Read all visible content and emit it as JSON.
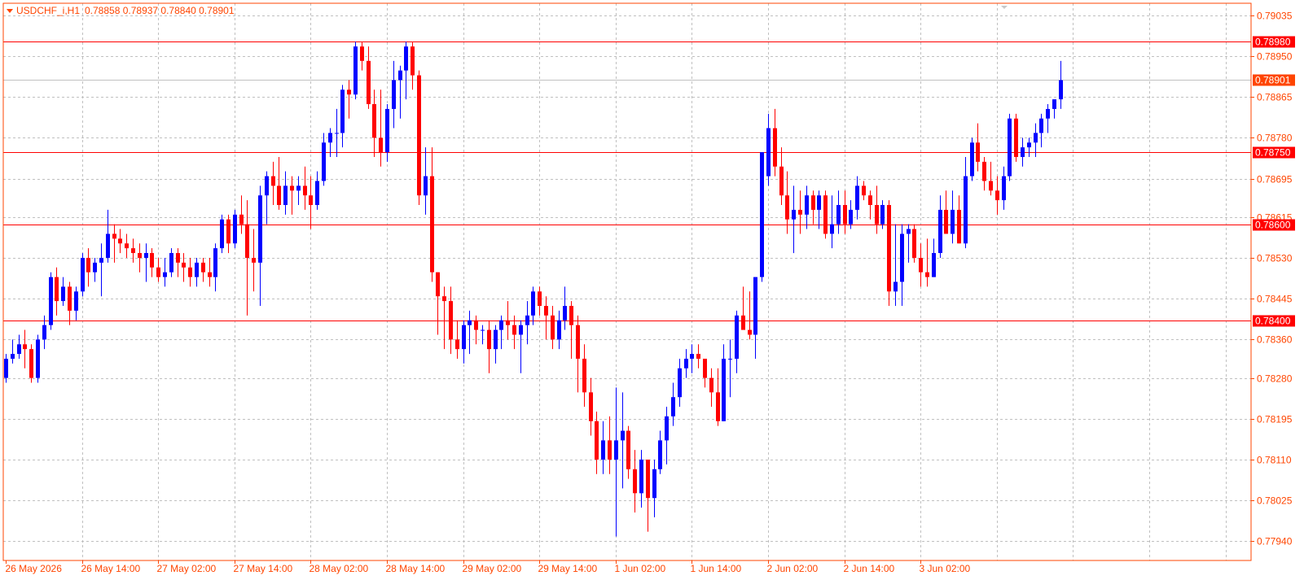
{
  "header": {
    "symbol": "USDCHF_i,H1",
    "ohlc": "0.78858 0.78937 0.78840 0.78901"
  },
  "colors": {
    "bull": "#0000ff",
    "bear": "#ff0000",
    "grid": "#c0c0c0",
    "frame": "#ff4500",
    "axis_text": "#ff4500",
    "level_line": "#ff0000",
    "bid_line": "#c0c0c0"
  },
  "chart_data": {
    "type": "candlestick",
    "symbol": "USDCHF_i",
    "timeframe": "H1",
    "ylim": [
      0.779,
      0.7906
    ],
    "y_ticks": [
      "0.79035",
      "0.78950",
      "0.78865",
      "0.78780",
      "0.78695",
      "0.78615",
      "0.78530",
      "0.78445",
      "0.78360",
      "0.78280",
      "0.78195",
      "0.78110",
      "0.78025",
      "0.77940"
    ],
    "x_labels": [
      "26 May 2026",
      "26 May 14:00",
      "27 May 02:00",
      "27 May 14:00",
      "28 May 02:00",
      "28 May 14:00",
      "29 May 02:00",
      "29 May 14:00",
      "1 Jun 02:00",
      "1 Jun 14:00",
      "2 Jun 02:00",
      "2 Jun 14:00",
      "3 Jun 02:00"
    ],
    "x_label_bar_index": [
      0,
      12,
      24,
      36,
      48,
      60,
      72,
      84,
      96,
      108,
      120,
      132,
      144
    ],
    "levels": [
      {
        "price": 0.7898,
        "label": "0.78980"
      },
      {
        "price": 0.7875,
        "label": "0.78750"
      },
      {
        "price": 0.786,
        "label": "0.78600"
      },
      {
        "price": 0.784,
        "label": "0.78400"
      }
    ],
    "current_price": {
      "price": 0.78901,
      "label": "0.78901"
    },
    "candles": [
      [
        0.7828,
        0.7833,
        0.7827,
        0.7832
      ],
      [
        0.7832,
        0.7836,
        0.7831,
        0.7833
      ],
      [
        0.7833,
        0.7837,
        0.7832,
        0.7835
      ],
      [
        0.7835,
        0.7838,
        0.783,
        0.7834
      ],
      [
        0.7834,
        0.7835,
        0.7827,
        0.7828
      ],
      [
        0.7828,
        0.7837,
        0.7827,
        0.7836
      ],
      [
        0.7836,
        0.7841,
        0.7834,
        0.7839
      ],
      [
        0.7839,
        0.785,
        0.7838,
        0.7849
      ],
      [
        0.7849,
        0.7851,
        0.7841,
        0.7844
      ],
      [
        0.7844,
        0.7849,
        0.7843,
        0.7847
      ],
      [
        0.7847,
        0.7848,
        0.7839,
        0.7842
      ],
      [
        0.7842,
        0.7847,
        0.784,
        0.7846
      ],
      [
        0.7846,
        0.7854,
        0.7845,
        0.7853
      ],
      [
        0.7853,
        0.7855,
        0.7847,
        0.785
      ],
      [
        0.785,
        0.7853,
        0.7848,
        0.7852
      ],
      [
        0.7852,
        0.7856,
        0.7845,
        0.7853
      ],
      [
        0.7853,
        0.7863,
        0.7852,
        0.7858
      ],
      [
        0.7858,
        0.786,
        0.7852,
        0.7857
      ],
      [
        0.7857,
        0.7859,
        0.7854,
        0.7856
      ],
      [
        0.7856,
        0.7858,
        0.7853,
        0.7855
      ],
      [
        0.7855,
        0.7857,
        0.7852,
        0.7854
      ],
      [
        0.7854,
        0.7856,
        0.785,
        0.7853
      ],
      [
        0.7853,
        0.7856,
        0.7848,
        0.7854
      ],
      [
        0.7854,
        0.7855,
        0.7849,
        0.7851
      ],
      [
        0.7851,
        0.7853,
        0.7848,
        0.7849
      ],
      [
        0.7849,
        0.7853,
        0.7847,
        0.785
      ],
      [
        0.785,
        0.7855,
        0.7849,
        0.7854
      ],
      [
        0.7854,
        0.7855,
        0.7849,
        0.7852
      ],
      [
        0.7852,
        0.7854,
        0.7848,
        0.7851
      ],
      [
        0.7851,
        0.7853,
        0.7847,
        0.7849
      ],
      [
        0.7849,
        0.7853,
        0.7847,
        0.7852
      ],
      [
        0.7852,
        0.7853,
        0.7848,
        0.785
      ],
      [
        0.785,
        0.7853,
        0.7847,
        0.7849
      ],
      [
        0.7849,
        0.7856,
        0.7846,
        0.7855
      ],
      [
        0.7855,
        0.7862,
        0.7854,
        0.7861
      ],
      [
        0.7861,
        0.7862,
        0.7854,
        0.7856
      ],
      [
        0.7856,
        0.7863,
        0.7855,
        0.7862
      ],
      [
        0.7862,
        0.7866,
        0.7858,
        0.786
      ],
      [
        0.786,
        0.7865,
        0.7841,
        0.7853
      ],
      [
        0.7853,
        0.7859,
        0.7846,
        0.7852
      ],
      [
        0.7852,
        0.7868,
        0.7843,
        0.7866
      ],
      [
        0.7866,
        0.7871,
        0.786,
        0.787
      ],
      [
        0.787,
        0.7873,
        0.7864,
        0.7868
      ],
      [
        0.7868,
        0.7874,
        0.7863,
        0.7864
      ],
      [
        0.7864,
        0.7871,
        0.7862,
        0.7868
      ],
      [
        0.7868,
        0.787,
        0.7862,
        0.7867
      ],
      [
        0.7867,
        0.787,
        0.7864,
        0.7868
      ],
      [
        0.7868,
        0.7872,
        0.7863,
        0.7866
      ],
      [
        0.7866,
        0.787,
        0.7859,
        0.7864
      ],
      [
        0.7864,
        0.7871,
        0.7863,
        0.7869
      ],
      [
        0.7869,
        0.7879,
        0.7868,
        0.7877
      ],
      [
        0.7877,
        0.788,
        0.7874,
        0.7879
      ],
      [
        0.7879,
        0.7884,
        0.7874,
        0.7879
      ],
      [
        0.7879,
        0.7889,
        0.7876,
        0.7888
      ],
      [
        0.7888,
        0.789,
        0.7882,
        0.7887
      ],
      [
        0.7887,
        0.7898,
        0.7886,
        0.7897
      ],
      [
        0.7897,
        0.7898,
        0.7892,
        0.7894
      ],
      [
        0.7894,
        0.7897,
        0.7884,
        0.7885
      ],
      [
        0.7885,
        0.7888,
        0.7874,
        0.7878
      ],
      [
        0.7878,
        0.7888,
        0.7872,
        0.7875
      ],
      [
        0.7875,
        0.7885,
        0.7873,
        0.7884
      ],
      [
        0.7884,
        0.7894,
        0.788,
        0.789
      ],
      [
        0.789,
        0.7893,
        0.7882,
        0.7892
      ],
      [
        0.7892,
        0.7898,
        0.7886,
        0.7897
      ],
      [
        0.7897,
        0.7898,
        0.7888,
        0.7891
      ],
      [
        0.7891,
        0.7892,
        0.7864,
        0.7866
      ],
      [
        0.7866,
        0.7876,
        0.7862,
        0.787
      ],
      [
        0.787,
        0.7876,
        0.7848,
        0.785
      ],
      [
        0.785,
        0.785,
        0.7837,
        0.7845
      ],
      [
        0.7845,
        0.7847,
        0.7834,
        0.7844
      ],
      [
        0.7844,
        0.7847,
        0.7833,
        0.7836
      ],
      [
        0.7836,
        0.784,
        0.7832,
        0.7834
      ],
      [
        0.7834,
        0.784,
        0.7831,
        0.7839
      ],
      [
        0.7839,
        0.7842,
        0.7833,
        0.784
      ],
      [
        0.784,
        0.7841,
        0.7835,
        0.7838
      ],
      [
        0.7838,
        0.7839,
        0.7835,
        0.7838
      ],
      [
        0.7838,
        0.784,
        0.7829,
        0.7834
      ],
      [
        0.7834,
        0.7839,
        0.7831,
        0.7838
      ],
      [
        0.7838,
        0.7841,
        0.7834,
        0.784
      ],
      [
        0.784,
        0.7844,
        0.7836,
        0.7839
      ],
      [
        0.7839,
        0.7841,
        0.7834,
        0.7837
      ],
      [
        0.7837,
        0.784,
        0.7829,
        0.7839
      ],
      [
        0.7839,
        0.7844,
        0.7835,
        0.7841
      ],
      [
        0.7841,
        0.7847,
        0.7839,
        0.7846
      ],
      [
        0.7846,
        0.7847,
        0.7841,
        0.7843
      ],
      [
        0.7843,
        0.7845,
        0.7836,
        0.7841
      ],
      [
        0.7841,
        0.7843,
        0.7834,
        0.7836
      ],
      [
        0.7836,
        0.7842,
        0.7834,
        0.784
      ],
      [
        0.784,
        0.7847,
        0.7838,
        0.7843
      ],
      [
        0.7843,
        0.7844,
        0.7832,
        0.7839
      ],
      [
        0.7839,
        0.7841,
        0.7825,
        0.7832
      ],
      [
        0.7832,
        0.7835,
        0.7822,
        0.7825
      ],
      [
        0.7825,
        0.7828,
        0.7816,
        0.7819
      ],
      [
        0.7819,
        0.7821,
        0.7808,
        0.7811
      ],
      [
        0.7811,
        0.7819,
        0.7808,
        0.7815
      ],
      [
        0.7815,
        0.782,
        0.7808,
        0.7811
      ],
      [
        0.7811,
        0.7826,
        0.7795,
        0.7815
      ],
      [
        0.7815,
        0.7825,
        0.7805,
        0.7817
      ],
      [
        0.7817,
        0.7818,
        0.7807,
        0.7809
      ],
      [
        0.7809,
        0.7813,
        0.78,
        0.7804
      ],
      [
        0.7804,
        0.7813,
        0.7801,
        0.7811
      ],
      [
        0.7811,
        0.7811,
        0.7796,
        0.7803
      ],
      [
        0.7803,
        0.7811,
        0.7799,
        0.7809
      ],
      [
        0.7809,
        0.7817,
        0.7808,
        0.7815
      ],
      [
        0.7815,
        0.7822,
        0.781,
        0.782
      ],
      [
        0.782,
        0.7827,
        0.7818,
        0.7824
      ],
      [
        0.7824,
        0.7832,
        0.7822,
        0.783
      ],
      [
        0.783,
        0.7834,
        0.7828,
        0.7832
      ],
      [
        0.7832,
        0.7835,
        0.7829,
        0.7833
      ],
      [
        0.7833,
        0.7835,
        0.783,
        0.7832
      ],
      [
        0.7832,
        0.7832,
        0.7826,
        0.7828
      ],
      [
        0.7828,
        0.783,
        0.7822,
        0.7825
      ],
      [
        0.7825,
        0.783,
        0.7818,
        0.7819
      ],
      [
        0.7819,
        0.7835,
        0.7819,
        0.7832
      ],
      [
        0.7832,
        0.7836,
        0.7824,
        0.7832
      ],
      [
        0.7832,
        0.7842,
        0.7829,
        0.7841
      ],
      [
        0.7841,
        0.7847,
        0.7838,
        0.7838
      ],
      [
        0.7838,
        0.7846,
        0.7836,
        0.7837
      ],
      [
        0.7837,
        0.7849,
        0.7832,
        0.7849
      ],
      [
        0.7849,
        0.7859,
        0.7848,
        0.7875
      ],
      [
        0.787,
        0.7883,
        0.7868,
        0.788
      ],
      [
        0.788,
        0.7884,
        0.787,
        0.7872
      ],
      [
        0.7872,
        0.7876,
        0.7864,
        0.7866
      ],
      [
        0.7866,
        0.7871,
        0.7858,
        0.7861
      ],
      [
        0.7861,
        0.7868,
        0.7854,
        0.7863
      ],
      [
        0.7863,
        0.7867,
        0.7858,
        0.7862
      ],
      [
        0.7862,
        0.7868,
        0.7859,
        0.7866
      ],
      [
        0.7866,
        0.7867,
        0.786,
        0.7863
      ],
      [
        0.7863,
        0.7867,
        0.7859,
        0.7866
      ],
      [
        0.7866,
        0.7867,
        0.7857,
        0.7858
      ],
      [
        0.7858,
        0.7866,
        0.7855,
        0.786
      ],
      [
        0.786,
        0.7867,
        0.7858,
        0.7864
      ],
      [
        0.7864,
        0.7867,
        0.7858,
        0.786
      ],
      [
        0.786,
        0.7865,
        0.7859,
        0.7863
      ],
      [
        0.7863,
        0.787,
        0.7861,
        0.7868
      ],
      [
        0.7868,
        0.7869,
        0.7865,
        0.7866
      ],
      [
        0.7866,
        0.7867,
        0.7861,
        0.7864
      ],
      [
        0.7864,
        0.7868,
        0.7858,
        0.786
      ],
      [
        0.786,
        0.7865,
        0.7859,
        0.7864
      ],
      [
        0.7864,
        0.7865,
        0.7843,
        0.7846
      ],
      [
        0.7846,
        0.786,
        0.7843,
        0.7848
      ],
      [
        0.7848,
        0.786,
        0.7843,
        0.7858
      ],
      [
        0.7858,
        0.786,
        0.7852,
        0.7859
      ],
      [
        0.7859,
        0.786,
        0.7852,
        0.7853
      ],
      [
        0.7853,
        0.7856,
        0.7847,
        0.785
      ],
      [
        0.785,
        0.7857,
        0.7847,
        0.7849
      ],
      [
        0.7849,
        0.7857,
        0.7849,
        0.7854
      ],
      [
        0.7854,
        0.7866,
        0.7853,
        0.7863
      ],
      [
        0.7863,
        0.7867,
        0.7858,
        0.7858
      ],
      [
        0.7858,
        0.7867,
        0.7856,
        0.7863
      ],
      [
        0.7863,
        0.7866,
        0.7856,
        0.7856
      ],
      [
        0.7856,
        0.7874,
        0.7855,
        0.787
      ],
      [
        0.787,
        0.7878,
        0.7869,
        0.7877
      ],
      [
        0.7877,
        0.7881,
        0.7871,
        0.7873
      ],
      [
        0.7873,
        0.7874,
        0.7867,
        0.7869
      ],
      [
        0.7869,
        0.7873,
        0.7866,
        0.7867
      ],
      [
        0.7867,
        0.787,
        0.7862,
        0.7865
      ],
      [
        0.7865,
        0.7872,
        0.7863,
        0.787
      ],
      [
        0.787,
        0.7883,
        0.7869,
        0.7882
      ],
      [
        0.7882,
        0.7883,
        0.7873,
        0.7874
      ],
      [
        0.7874,
        0.7878,
        0.7872,
        0.7876
      ],
      [
        0.7876,
        0.7878,
        0.7874,
        0.7877
      ],
      [
        0.7877,
        0.7881,
        0.7874,
        0.7879
      ],
      [
        0.7879,
        0.7883,
        0.7876,
        0.7882
      ],
      [
        0.7882,
        0.7885,
        0.7879,
        0.7884
      ],
      [
        0.7884,
        0.7886,
        0.7882,
        0.7886
      ],
      [
        0.7886,
        0.7894,
        0.7884,
        0.789
      ]
    ]
  }
}
